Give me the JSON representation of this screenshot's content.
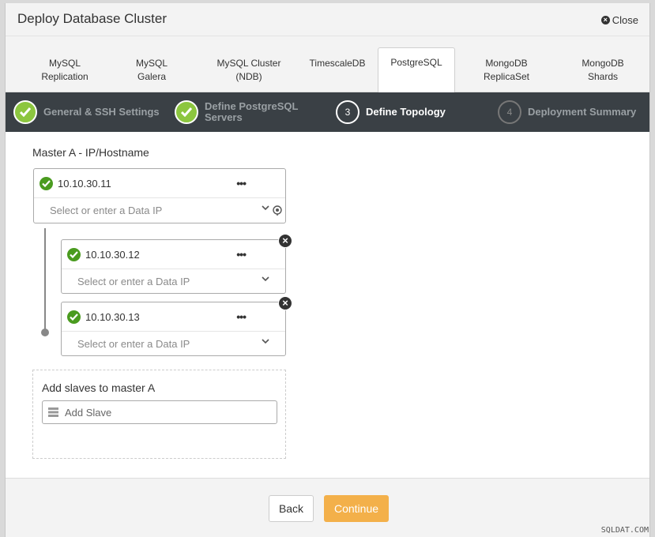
{
  "dialog": {
    "title": "Deploy Database Cluster",
    "close_label": "Close"
  },
  "tabs": [
    {
      "line1": "MySQL",
      "line2": "Replication"
    },
    {
      "line1": "MySQL",
      "line2": "Galera"
    },
    {
      "line1": "MySQL Cluster",
      "line2": "(NDB)"
    },
    {
      "line1": "TimescaleDB",
      "line2": ""
    },
    {
      "line1": "PostgreSQL",
      "line2": ""
    },
    {
      "line1": "MongoDB",
      "line2": "ReplicaSet"
    },
    {
      "line1": "MongoDB",
      "line2": "Shards"
    }
  ],
  "active_tab": "PostgreSQL",
  "steps": [
    {
      "label": "General & SSH Settings",
      "state": "done"
    },
    {
      "label_line1": "Define PostgreSQL",
      "label_line2": "Servers",
      "state": "done"
    },
    {
      "number": "3",
      "label": "Define Topology",
      "state": "active"
    },
    {
      "number": "4",
      "label": "Deployment Summary",
      "state": "pending"
    }
  ],
  "topology": {
    "master_label": "Master A - IP/Hostname",
    "master": {
      "ip": "10.10.30.11",
      "data_ip_placeholder": "Select or enter a Data IP",
      "more": "•••"
    },
    "slaves": [
      {
        "ip": "10.10.30.12",
        "data_ip_placeholder": "Select or enter a Data IP",
        "more": "•••",
        "remove": "×"
      },
      {
        "ip": "10.10.30.13",
        "data_ip_placeholder": "Select or enter a Data IP",
        "more": "•••",
        "remove": "×"
      }
    ],
    "add_slaves_label": "Add slaves to master A",
    "add_slave_placeholder": "Add Slave"
  },
  "footer": {
    "back_label": "Back",
    "continue_label": "Continue"
  },
  "watermark": "SQLDAT.COM",
  "colors": {
    "accent": "#f3b04a",
    "success": "#4a9b1f",
    "step_done": "#8cc63f",
    "stepbar": "#3a4045"
  }
}
